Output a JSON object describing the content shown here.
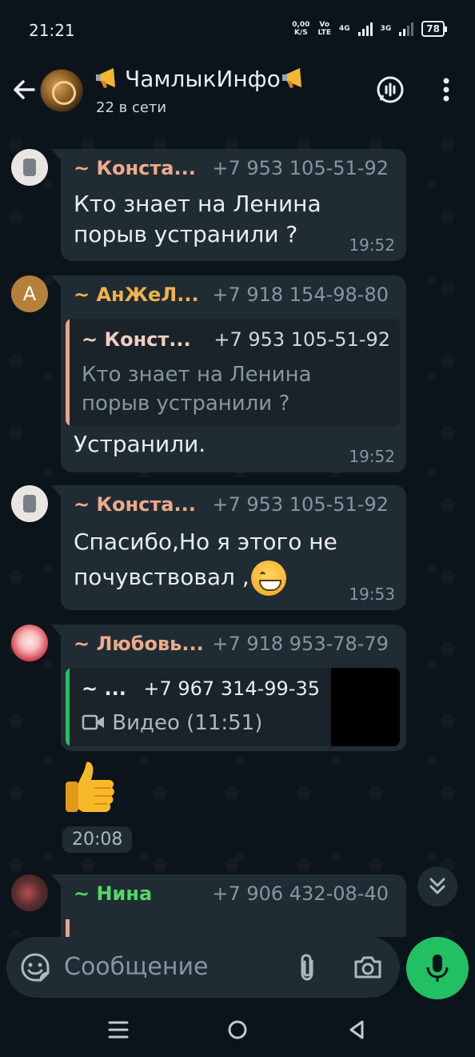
{
  "status_bar": {
    "time": "21:21",
    "net_speed_value": "0,00",
    "net_speed_unit": "K/S",
    "volte": "Vo",
    "lte": "LTE",
    "sim1": "4G",
    "sim2": "3G",
    "battery": "78"
  },
  "header": {
    "title": "ЧамлыкИнфо",
    "subtitle": "22 в сети"
  },
  "messages": [
    {
      "sender": "~ Конста...",
      "sender_color": "#f0a98c",
      "phone": "+7 953 105-51-92",
      "text_lines": [
        "Кто знает на Ленина",
        "порыв устранили ?"
      ],
      "time": "19:52"
    },
    {
      "avatar_letter": "A",
      "sender": "~ АнЖеЛ...",
      "sender_color": "#f2b24c",
      "phone": "+7 918 154-98-80",
      "quote": {
        "sender": "~ Конст...",
        "sender_color": "#f0cfc0",
        "phone": "+7 953 105-51-92",
        "text_lines": [
          "Кто знает на Ленина",
          "порыв устранили ?"
        ]
      },
      "text": "Устранили.",
      "time": "19:52"
    },
    {
      "sender": "~ Конста...",
      "sender_color": "#f0a98c",
      "phone": "+7 953 105-51-92",
      "text_line1": "Спасибо,Но я этого не",
      "text_line2": "почувствовал ,",
      "emoji": "grinning-face-smiling-eyes",
      "time": "19:53"
    },
    {
      "sender": "~ Любовь...",
      "sender_color": "#f0a98c",
      "phone": "+7 918 953-78-79",
      "quote": {
        "sender": "~ ...",
        "sender_color": "#e9edef",
        "phone": "+7 967 314-99-35",
        "media_label": "Видео (11:51)",
        "bar_color": "#21c063"
      }
    },
    {
      "sticker": "thumbs-up",
      "time": "20:08"
    },
    {
      "sender": "~ Нина",
      "sender_color": "#53d769",
      "phone": "+7 906 432-08-40"
    }
  ],
  "composer": {
    "placeholder": "Сообщение"
  },
  "colors": {
    "background": "#0b141a",
    "bubble": "#202c33",
    "accent_green": "#21c063",
    "meta_gray": "#8696a0"
  }
}
